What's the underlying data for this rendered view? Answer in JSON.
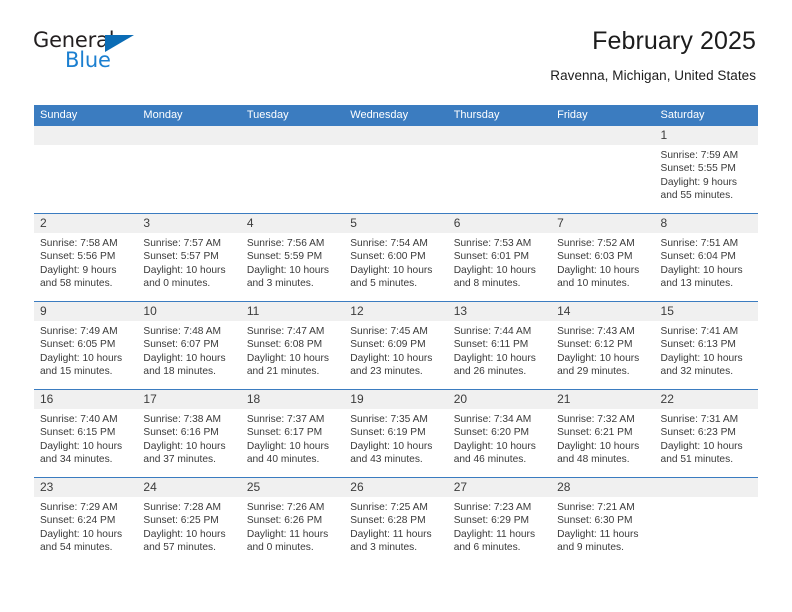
{
  "logo": {
    "word_one": "General",
    "word_two": "Blue",
    "triangle_color": "#0b6cb5",
    "blue_color": "#1b7fd0"
  },
  "header": {
    "title": "February 2025",
    "location": "Ravenna, Michigan, United States"
  },
  "theme": {
    "header_blue": "#3b7cc0",
    "day_strip_gray": "#f0f0f0",
    "text_color": "#3a3a3a"
  },
  "weekdays": [
    "Sunday",
    "Monday",
    "Tuesday",
    "Wednesday",
    "Thursday",
    "Friday",
    "Saturday"
  ],
  "weeks": [
    [
      {
        "day": "",
        "sunrise": "",
        "sunset": "",
        "daylight_line1": "",
        "daylight_line2": "",
        "empty": true
      },
      {
        "day": "",
        "sunrise": "",
        "sunset": "",
        "daylight_line1": "",
        "daylight_line2": "",
        "empty": true
      },
      {
        "day": "",
        "sunrise": "",
        "sunset": "",
        "daylight_line1": "",
        "daylight_line2": "",
        "empty": true
      },
      {
        "day": "",
        "sunrise": "",
        "sunset": "",
        "daylight_line1": "",
        "daylight_line2": "",
        "empty": true
      },
      {
        "day": "",
        "sunrise": "",
        "sunset": "",
        "daylight_line1": "",
        "daylight_line2": "",
        "empty": true
      },
      {
        "day": "",
        "sunrise": "",
        "sunset": "",
        "daylight_line1": "",
        "daylight_line2": "",
        "empty": true
      },
      {
        "day": "1",
        "sunrise": "Sunrise: 7:59 AM",
        "sunset": "Sunset: 5:55 PM",
        "daylight_line1": "Daylight: 9 hours",
        "daylight_line2": "and 55 minutes.",
        "empty": false
      }
    ],
    [
      {
        "day": "2",
        "sunrise": "Sunrise: 7:58 AM",
        "sunset": "Sunset: 5:56 PM",
        "daylight_line1": "Daylight: 9 hours",
        "daylight_line2": "and 58 minutes.",
        "empty": false
      },
      {
        "day": "3",
        "sunrise": "Sunrise: 7:57 AM",
        "sunset": "Sunset: 5:57 PM",
        "daylight_line1": "Daylight: 10 hours",
        "daylight_line2": "and 0 minutes.",
        "empty": false
      },
      {
        "day": "4",
        "sunrise": "Sunrise: 7:56 AM",
        "sunset": "Sunset: 5:59 PM",
        "daylight_line1": "Daylight: 10 hours",
        "daylight_line2": "and 3 minutes.",
        "empty": false
      },
      {
        "day": "5",
        "sunrise": "Sunrise: 7:54 AM",
        "sunset": "Sunset: 6:00 PM",
        "daylight_line1": "Daylight: 10 hours",
        "daylight_line2": "and 5 minutes.",
        "empty": false
      },
      {
        "day": "6",
        "sunrise": "Sunrise: 7:53 AM",
        "sunset": "Sunset: 6:01 PM",
        "daylight_line1": "Daylight: 10 hours",
        "daylight_line2": "and 8 minutes.",
        "empty": false
      },
      {
        "day": "7",
        "sunrise": "Sunrise: 7:52 AM",
        "sunset": "Sunset: 6:03 PM",
        "daylight_line1": "Daylight: 10 hours",
        "daylight_line2": "and 10 minutes.",
        "empty": false
      },
      {
        "day": "8",
        "sunrise": "Sunrise: 7:51 AM",
        "sunset": "Sunset: 6:04 PM",
        "daylight_line1": "Daylight: 10 hours",
        "daylight_line2": "and 13 minutes.",
        "empty": false
      }
    ],
    [
      {
        "day": "9",
        "sunrise": "Sunrise: 7:49 AM",
        "sunset": "Sunset: 6:05 PM",
        "daylight_line1": "Daylight: 10 hours",
        "daylight_line2": "and 15 minutes.",
        "empty": false
      },
      {
        "day": "10",
        "sunrise": "Sunrise: 7:48 AM",
        "sunset": "Sunset: 6:07 PM",
        "daylight_line1": "Daylight: 10 hours",
        "daylight_line2": "and 18 minutes.",
        "empty": false
      },
      {
        "day": "11",
        "sunrise": "Sunrise: 7:47 AM",
        "sunset": "Sunset: 6:08 PM",
        "daylight_line1": "Daylight: 10 hours",
        "daylight_line2": "and 21 minutes.",
        "empty": false
      },
      {
        "day": "12",
        "sunrise": "Sunrise: 7:45 AM",
        "sunset": "Sunset: 6:09 PM",
        "daylight_line1": "Daylight: 10 hours",
        "daylight_line2": "and 23 minutes.",
        "empty": false
      },
      {
        "day": "13",
        "sunrise": "Sunrise: 7:44 AM",
        "sunset": "Sunset: 6:11 PM",
        "daylight_line1": "Daylight: 10 hours",
        "daylight_line2": "and 26 minutes.",
        "empty": false
      },
      {
        "day": "14",
        "sunrise": "Sunrise: 7:43 AM",
        "sunset": "Sunset: 6:12 PM",
        "daylight_line1": "Daylight: 10 hours",
        "daylight_line2": "and 29 minutes.",
        "empty": false
      },
      {
        "day": "15",
        "sunrise": "Sunrise: 7:41 AM",
        "sunset": "Sunset: 6:13 PM",
        "daylight_line1": "Daylight: 10 hours",
        "daylight_line2": "and 32 minutes.",
        "empty": false
      }
    ],
    [
      {
        "day": "16",
        "sunrise": "Sunrise: 7:40 AM",
        "sunset": "Sunset: 6:15 PM",
        "daylight_line1": "Daylight: 10 hours",
        "daylight_line2": "and 34 minutes.",
        "empty": false
      },
      {
        "day": "17",
        "sunrise": "Sunrise: 7:38 AM",
        "sunset": "Sunset: 6:16 PM",
        "daylight_line1": "Daylight: 10 hours",
        "daylight_line2": "and 37 minutes.",
        "empty": false
      },
      {
        "day": "18",
        "sunrise": "Sunrise: 7:37 AM",
        "sunset": "Sunset: 6:17 PM",
        "daylight_line1": "Daylight: 10 hours",
        "daylight_line2": "and 40 minutes.",
        "empty": false
      },
      {
        "day": "19",
        "sunrise": "Sunrise: 7:35 AM",
        "sunset": "Sunset: 6:19 PM",
        "daylight_line1": "Daylight: 10 hours",
        "daylight_line2": "and 43 minutes.",
        "empty": false
      },
      {
        "day": "20",
        "sunrise": "Sunrise: 7:34 AM",
        "sunset": "Sunset: 6:20 PM",
        "daylight_line1": "Daylight: 10 hours",
        "daylight_line2": "and 46 minutes.",
        "empty": false
      },
      {
        "day": "21",
        "sunrise": "Sunrise: 7:32 AM",
        "sunset": "Sunset: 6:21 PM",
        "daylight_line1": "Daylight: 10 hours",
        "daylight_line2": "and 48 minutes.",
        "empty": false
      },
      {
        "day": "22",
        "sunrise": "Sunrise: 7:31 AM",
        "sunset": "Sunset: 6:23 PM",
        "daylight_line1": "Daylight: 10 hours",
        "daylight_line2": "and 51 minutes.",
        "empty": false
      }
    ],
    [
      {
        "day": "23",
        "sunrise": "Sunrise: 7:29 AM",
        "sunset": "Sunset: 6:24 PM",
        "daylight_line1": "Daylight: 10 hours",
        "daylight_line2": "and 54 minutes.",
        "empty": false
      },
      {
        "day": "24",
        "sunrise": "Sunrise: 7:28 AM",
        "sunset": "Sunset: 6:25 PM",
        "daylight_line1": "Daylight: 10 hours",
        "daylight_line2": "and 57 minutes.",
        "empty": false
      },
      {
        "day": "25",
        "sunrise": "Sunrise: 7:26 AM",
        "sunset": "Sunset: 6:26 PM",
        "daylight_line1": "Daylight: 11 hours",
        "daylight_line2": "and 0 minutes.",
        "empty": false
      },
      {
        "day": "26",
        "sunrise": "Sunrise: 7:25 AM",
        "sunset": "Sunset: 6:28 PM",
        "daylight_line1": "Daylight: 11 hours",
        "daylight_line2": "and 3 minutes.",
        "empty": false
      },
      {
        "day": "27",
        "sunrise": "Sunrise: 7:23 AM",
        "sunset": "Sunset: 6:29 PM",
        "daylight_line1": "Daylight: 11 hours",
        "daylight_line2": "and 6 minutes.",
        "empty": false
      },
      {
        "day": "28",
        "sunrise": "Sunrise: 7:21 AM",
        "sunset": "Sunset: 6:30 PM",
        "daylight_line1": "Daylight: 11 hours",
        "daylight_line2": "and 9 minutes.",
        "empty": false
      },
      {
        "day": "",
        "sunrise": "",
        "sunset": "",
        "daylight_line1": "",
        "daylight_line2": "",
        "empty": true
      }
    ]
  ]
}
